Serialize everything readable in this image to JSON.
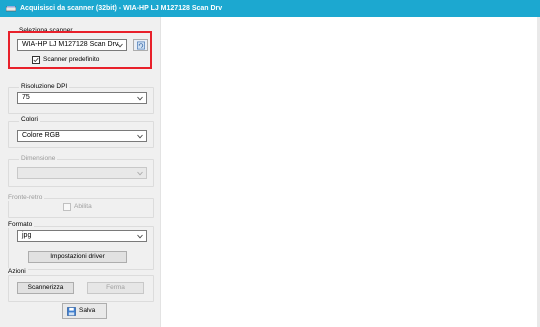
{
  "window": {
    "title": "Acquisisci da scanner (32bit) - WIA-HP LJ M127128 Scan Drv",
    "title_bar_color": "#1ca8d0"
  },
  "scanner": {
    "group_label": "Seleziona scanner",
    "selected": "WIA-HP LJ M127128 Scan Drv",
    "refresh_icon": "refresh-scanner-icon",
    "default_checkbox_label": "Scanner predefinito",
    "default_checked": true,
    "highlight_color": "#e8202a"
  },
  "resolution": {
    "group_label": "Risoluzione DPI",
    "selected": "75"
  },
  "colors": {
    "group_label": "Colori",
    "selected": "Colore RGB"
  },
  "dimension": {
    "group_label": "Dimensione",
    "selected": ""
  },
  "duplex": {
    "group_label": "Fronte-retro",
    "enable_label": "Abilita",
    "checked": false
  },
  "format": {
    "group_label": "Formato",
    "selected": "jpg",
    "driver_settings_button": "Impostazioni driver"
  },
  "actions": {
    "group_label": "Azioni",
    "scan_button": "Scannerizza",
    "stop_button": "Ferma",
    "save_button": "Salva",
    "save_icon": "save-disk-icon"
  }
}
